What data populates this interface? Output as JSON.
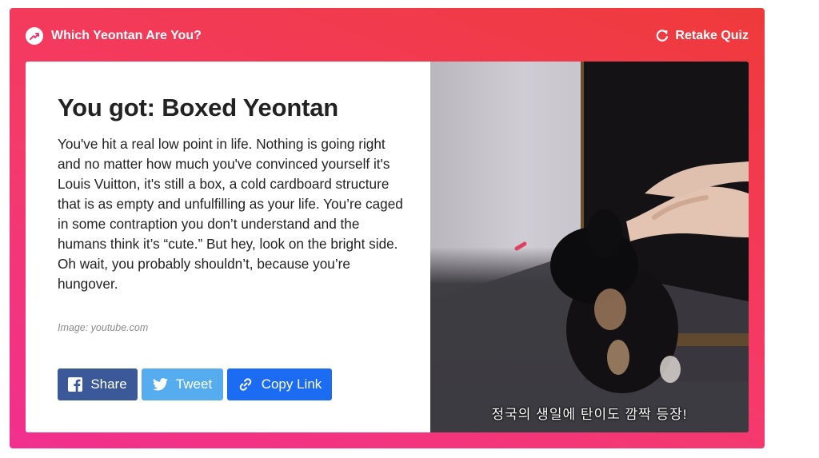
{
  "quiz": {
    "title": "Which Yeontan Are You?",
    "retake_label": "Retake Quiz"
  },
  "result": {
    "title": "You got: Boxed Yeontan",
    "description": "You've hit a real low point in life. Nothing is going right and no matter how much you've convinced yourself it's Louis Vuitton, it's still a box, a cold cardboard structure that is as empty and unfulfilling as your life. You’re caged in some contraption you don’t understand and the humans think it’s “cute.” But hey, look on the bright side. Oh wait, you probably shouldn’t, because you’re hungover.",
    "image_credit": "Image: youtube.com",
    "image_caption": "정국의 생일에 탄이도 깜짝 등장!"
  },
  "share": {
    "facebook_label": "Share",
    "twitter_label": "Tweet",
    "copy_label": "Copy Link"
  },
  "colors": {
    "gradient_start": "#f22f8f",
    "gradient_end": "#ef3a3a",
    "facebook": "#3b5998",
    "twitter": "#55acee",
    "copy_link": "#1b6cf2"
  },
  "icons": {
    "quiz": "trending-icon",
    "retake": "refresh-icon",
    "facebook": "facebook-icon",
    "twitter": "twitter-icon",
    "copy": "link-icon"
  }
}
